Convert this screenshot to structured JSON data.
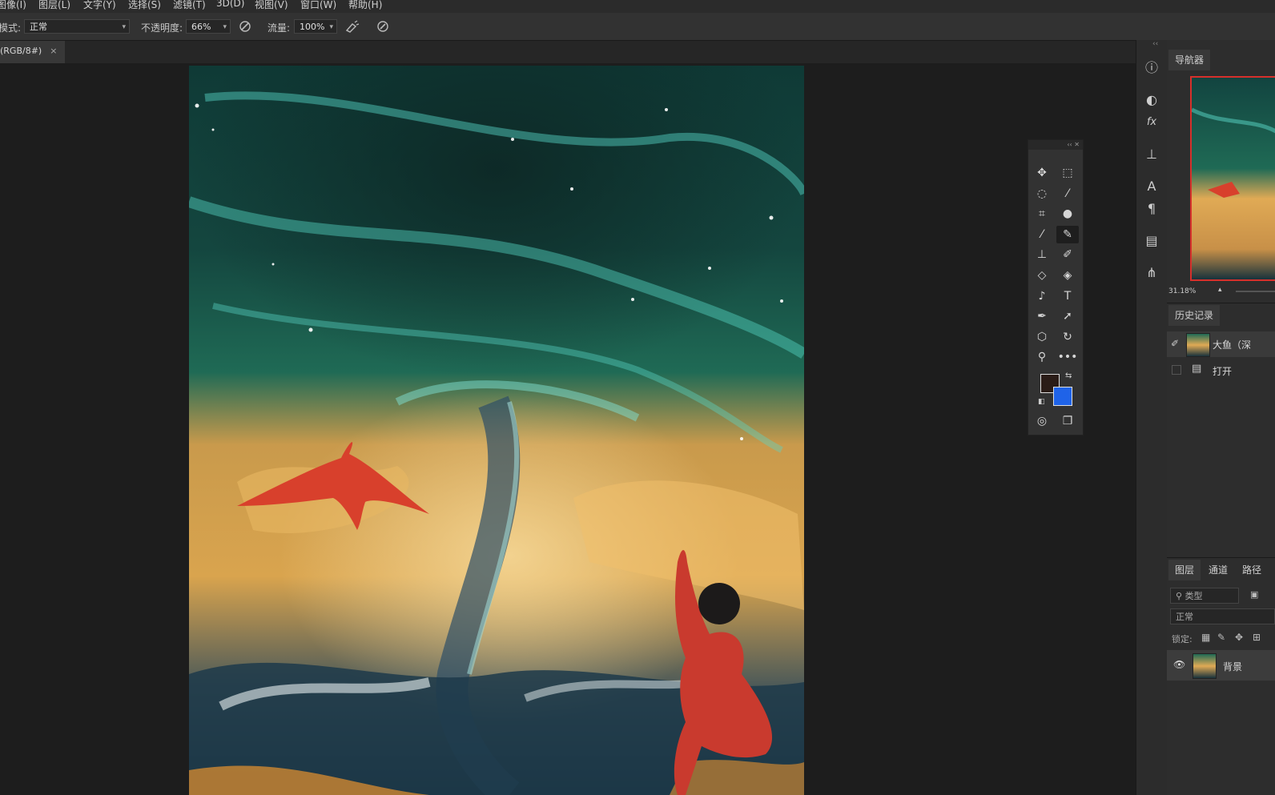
{
  "menu": [
    "图像(I)",
    "图层(L)",
    "文字(Y)",
    "选择(S)",
    "滤镜(T)",
    "3D(D)",
    "视图(V)",
    "窗口(W)",
    "帮助(H)"
  ],
  "options": {
    "mode_label": "模式:",
    "mode_value": "正常",
    "opacity_label": "不透明度:",
    "opacity_value": "66%",
    "flow_label": "流量:",
    "flow_value": "100%"
  },
  "document_tab": {
    "label": "(RGB/8#)",
    "close": "×"
  },
  "navigator": {
    "tab": "导航器",
    "zoom": "31.18%"
  },
  "history": {
    "tab": "历史记录",
    "items": [
      {
        "label": "大鱼（深"
      },
      {
        "label": "打开"
      }
    ]
  },
  "layers": {
    "tabs": [
      "图层",
      "通道",
      "路径"
    ],
    "filter_placeholder": "类型",
    "blend_mode": "正常",
    "lock_label": "锁定:",
    "items": [
      {
        "name": "背景"
      }
    ]
  },
  "colors": {
    "foreground": "#2a1c17",
    "background": "#1f63e8",
    "accent_red": "#d6302b"
  },
  "toolbox_icons": [
    "move-icon",
    "marquee-icon",
    "lasso-icon",
    "magic-wand-icon",
    "crop-icon",
    "spot-heal-icon",
    "eyedropper-icon",
    "brush-icon",
    "stamp-icon",
    "history-brush-icon",
    "eraser-icon",
    "paint-bucket-icon",
    "smudge-icon",
    "type-icon",
    "pen-icon",
    "path-select-icon",
    "shape-icon",
    "rotate-view-icon",
    "zoom-icon",
    "more-icon"
  ]
}
